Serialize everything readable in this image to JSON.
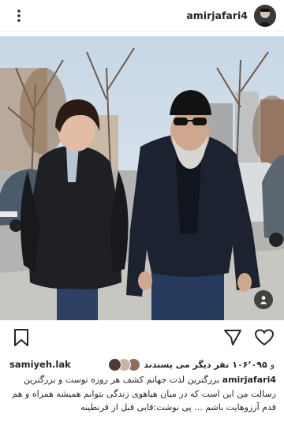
{
  "post": {
    "username": "amirjafari4",
    "icons": {
      "menu": "more-vertical-icon",
      "bookmark": "bookmark-icon",
      "share": "send-icon",
      "like": "heart-icon",
      "tag": "person-tag-icon"
    },
    "likes": {
      "liker": "samiyeh.lak",
      "count_text": "۱۰۶٬۰۹۵",
      "prefix": "و",
      "suffix": "نفر دیگر می پسندند"
    },
    "caption": {
      "user": "amirjafari4",
      "text": "بزرگترین لذت جهانم کشف هر روزه توست و بزرگترین رسالت من این است که در میان هیاهوی زندگی بتوانم همیشه همراه و هم قدم آرزوهایت باشم ... پی نوشت:قابی قبل از قرنطینه"
    }
  }
}
